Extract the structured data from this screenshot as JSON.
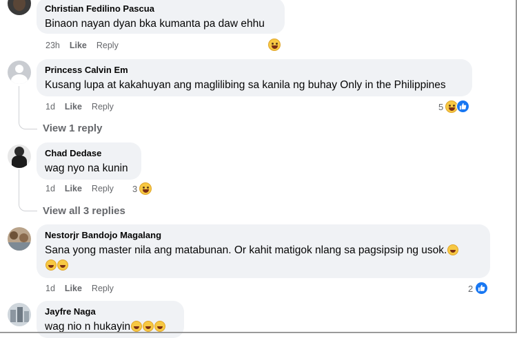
{
  "comments": [
    {
      "author": "Christian Fedilino Pascua",
      "text": "Binaon nayan dyan bka kumanta pa daw ehhu",
      "time": "23h",
      "like": "Like",
      "reply": "Reply",
      "reactions": {
        "count": "",
        "icons": [
          "haha-icon"
        ]
      }
    },
    {
      "author": "Princess Calvin Em",
      "text": "Kusang lupa at kakahuyan ang maglilibing sa kanila ng buhay Only in the Philippines",
      "time": "1d",
      "like": "Like",
      "reply": "Reply",
      "reactions": {
        "count": "5",
        "icons": [
          "haha-icon",
          "like-icon"
        ]
      },
      "view_replies": "View 1 reply"
    },
    {
      "author": "Chad Dedase",
      "text": "wag nyo na kunin",
      "time": "1d",
      "like": "Like",
      "reply": "Reply",
      "reactions": {
        "count": "3",
        "icons": [
          "haha-icon"
        ]
      },
      "view_replies": "View all 3 replies"
    },
    {
      "author": "Nestorjr Bandojo Magalang",
      "text": "Sana yong master nila ang matabunan. Or kahit matigok nlang sa pagsipsip ng usok.",
      "time": "1d",
      "like": "Like",
      "reply": "Reply",
      "reactions": {
        "count": "2",
        "icons": [
          "like-icon"
        ]
      }
    },
    {
      "author": "Jayfre Naga",
      "text": "wag nio n hukayin",
      "reactions": {
        "count": "",
        "icons": []
      }
    }
  ],
  "colors": {
    "bubble": "#f0f2f5",
    "secondary_text": "#65676b",
    "like_blue": "#1877f2",
    "haha_yellow": "#f7c843"
  }
}
